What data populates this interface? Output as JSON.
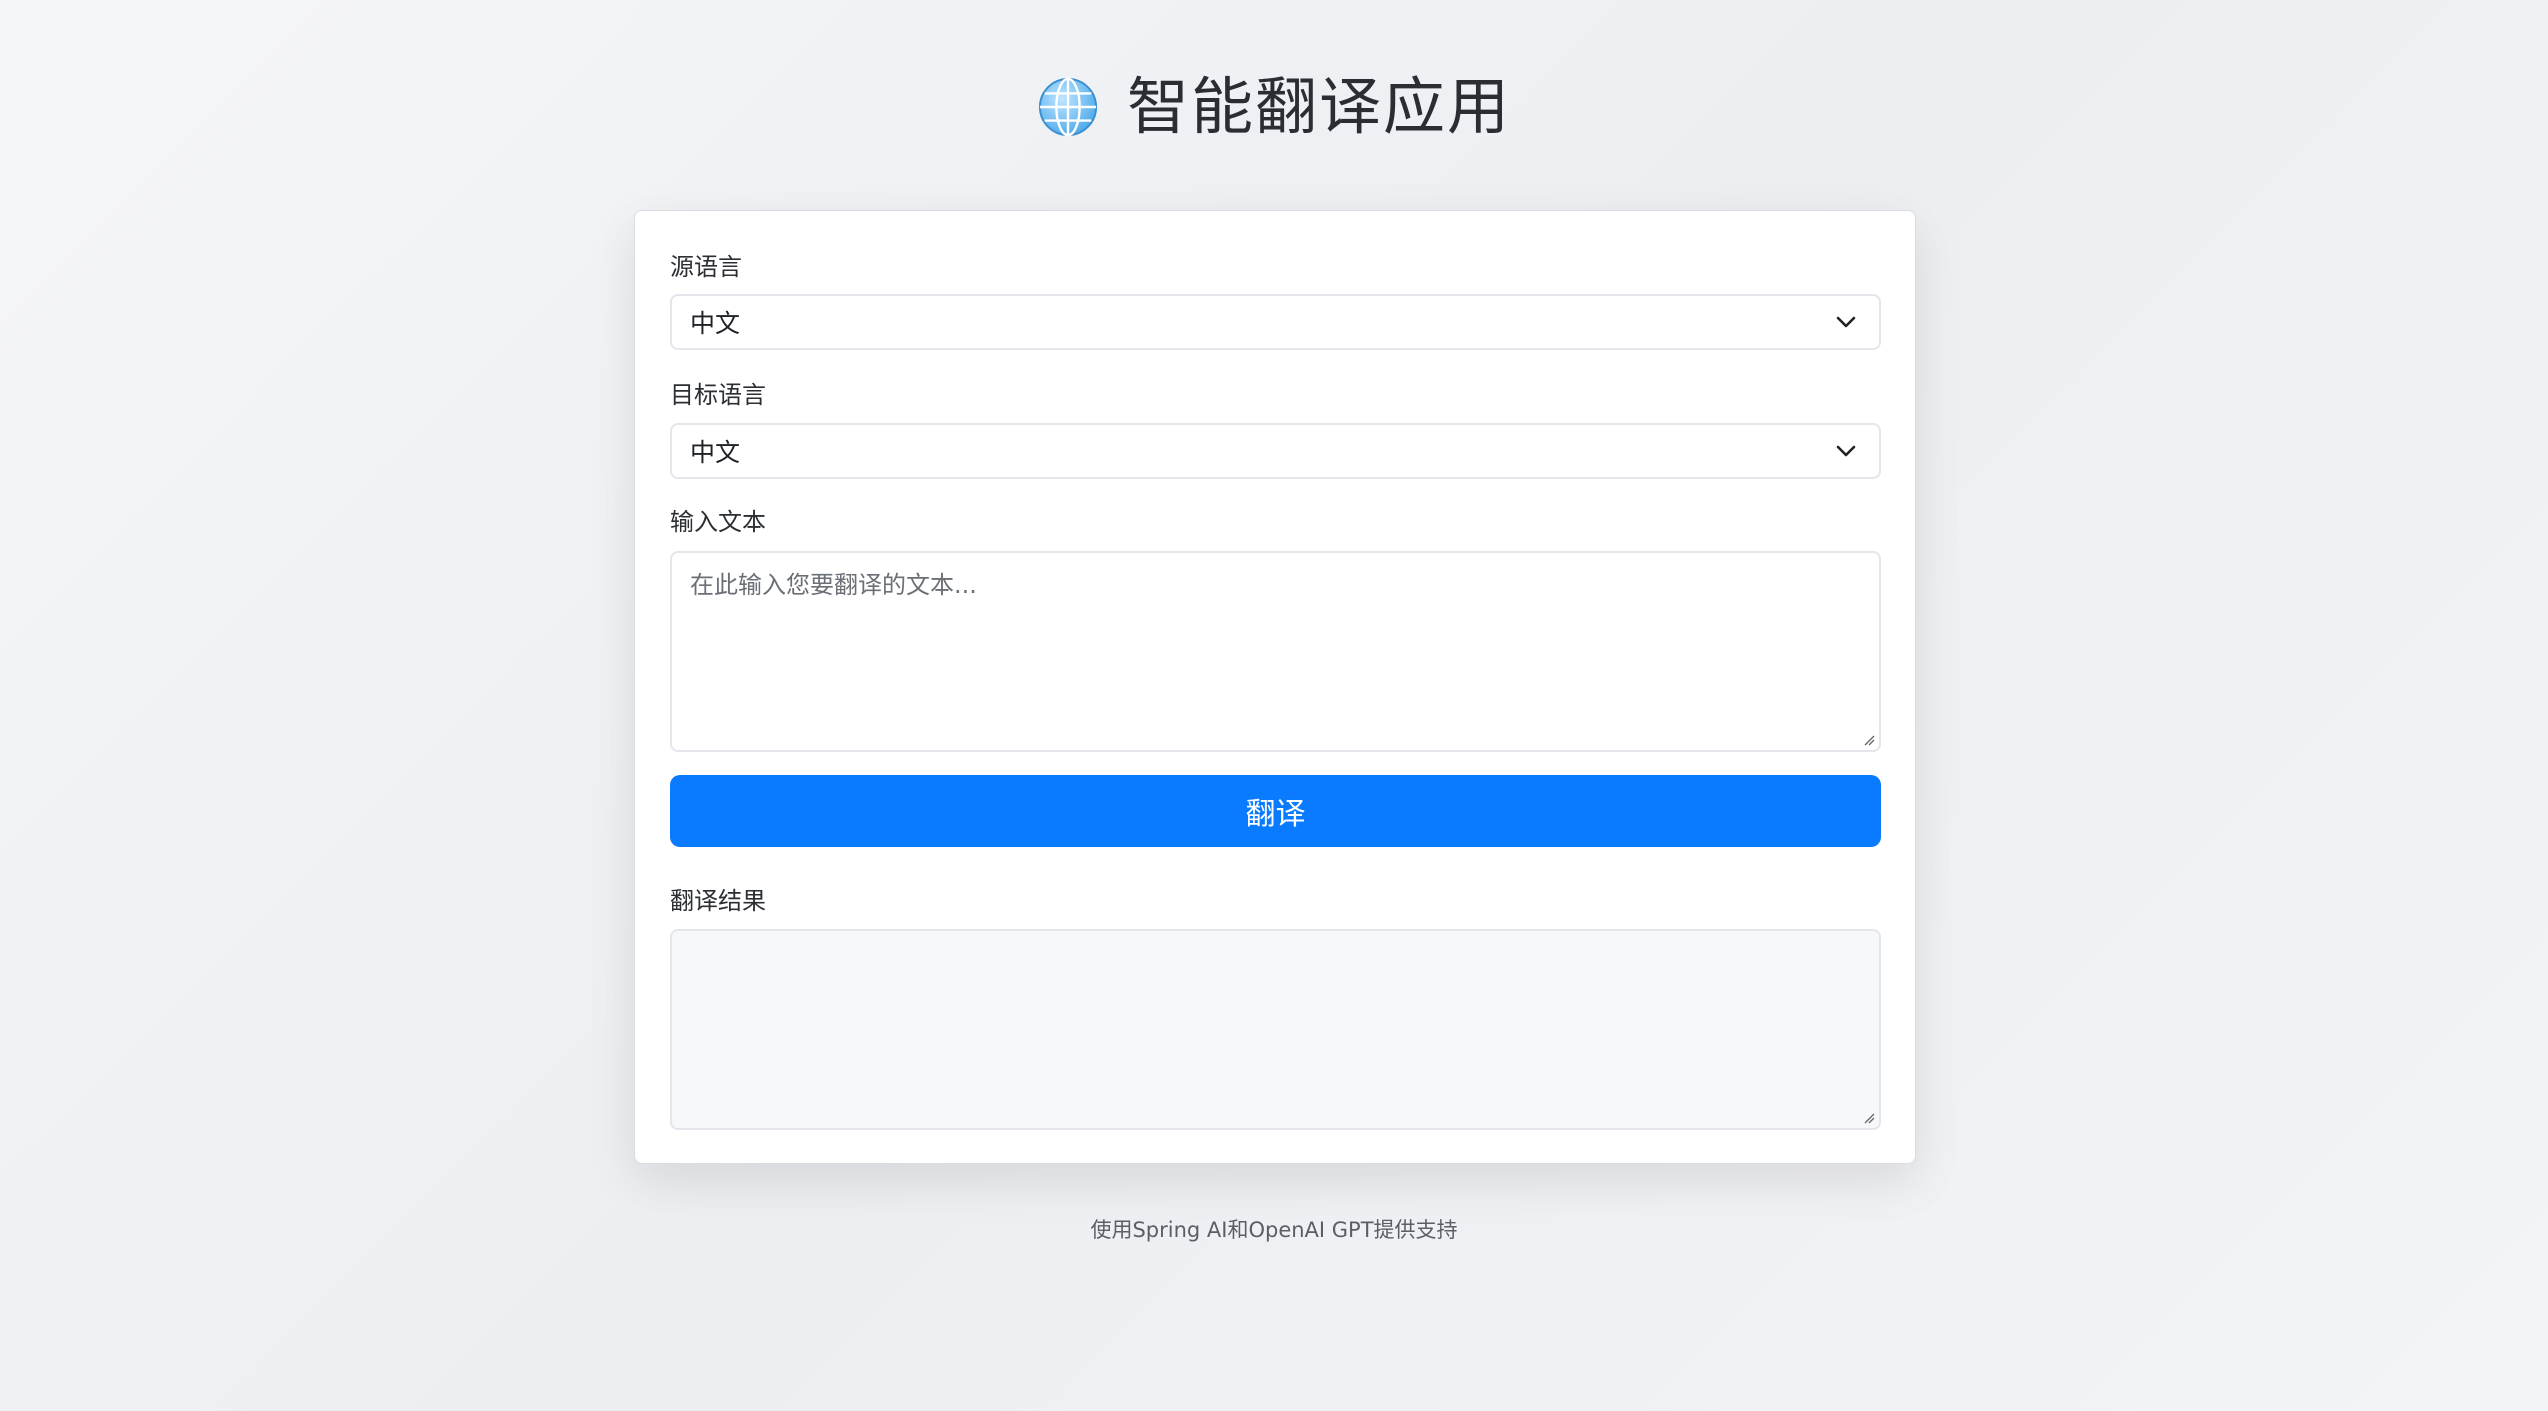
{
  "header": {
    "title": "智能翻译应用",
    "icon": "globe-icon"
  },
  "form": {
    "source_label": "源语言",
    "source_value": "中文",
    "target_label": "目标语言",
    "target_value": "中文",
    "input_label": "输入文本",
    "input_placeholder": "在此输入您要翻译的文本...",
    "translate_button": "翻译",
    "result_label": "翻译结果",
    "result_value": ""
  },
  "footer": {
    "text": "使用Spring AI和OpenAI GPT提供支持"
  },
  "colors": {
    "accent": "#0a7bff",
    "result_bg": "#f7f8fa"
  }
}
